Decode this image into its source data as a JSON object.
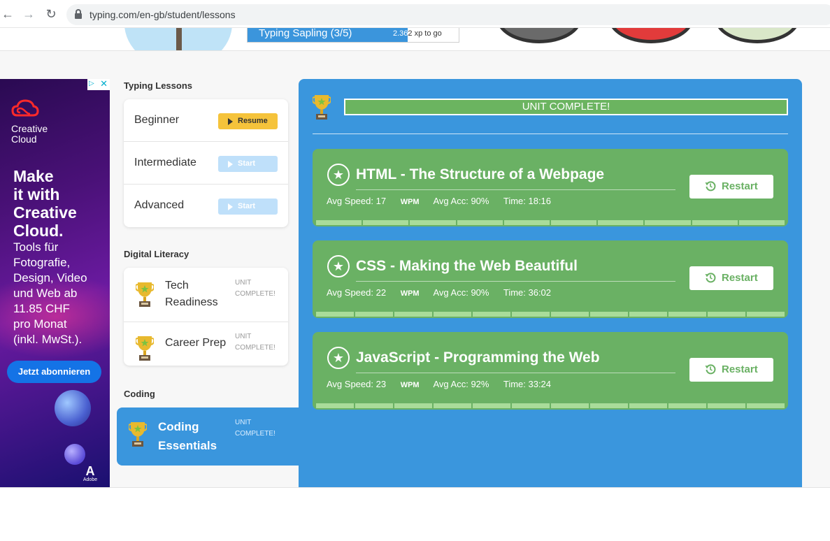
{
  "browser": {
    "url": "typing.com/en-gb/student/lessons",
    "back_glyph": "←",
    "forward_glyph": "→",
    "reload_glyph": "↻"
  },
  "header": {
    "level_label": "Typing Sapling (3/5)",
    "xp_number": "2.36",
    "xp_suffix": "2 xp to go",
    "badge_colors": [
      "#6a6a6a",
      "#e23b3b",
      "#d9e7c8"
    ]
  },
  "ad": {
    "choice": "▷",
    "close": "✕",
    "brand_line1": "Creative",
    "brand_line2": "Cloud",
    "headline_1": "Make",
    "headline_2": "it with",
    "headline_3": "Creative",
    "headline_4": "Cloud.",
    "copy_1": "Tools für",
    "copy_2": "Fotografie,",
    "copy_3": "Design, Video",
    "copy_4": "und Web ab",
    "copy_5": "11.85 CHF",
    "copy_6": "pro Monat",
    "copy_7": "(inkl. MwSt.).",
    "cta": "Jetzt abonnieren",
    "adobe_mark": "A",
    "adobe_text": "Adobe"
  },
  "sidebar": {
    "typing_title": "Typing Lessons",
    "typing_items": [
      {
        "label": "Beginner",
        "action": "Resume"
      },
      {
        "label": "Intermediate",
        "action": "Start"
      },
      {
        "label": "Advanced",
        "action": "Start"
      }
    ],
    "literacy_title": "Digital Literacy",
    "literacy_items": [
      {
        "name_1": "Tech",
        "name_2": "Readiness",
        "status_1": "UNIT",
        "status_2": "COMPLETE!"
      },
      {
        "name_1": "Career Prep",
        "status_1": "UNIT",
        "status_2": "COMPLETE!"
      }
    ],
    "coding_title": "Coding",
    "coding_item": {
      "name_1": "Coding",
      "name_2": "Essentials",
      "status_1": "UNIT",
      "status_2": "COMPLETE!"
    }
  },
  "content": {
    "banner": "UNIT COMPLETE!",
    "courses": [
      {
        "title": "HTML - The Structure of a Webpage",
        "speed_label": "Avg Speed: 17",
        "wpm": "WPM",
        "acc": "Avg Acc: 90%",
        "time": "Time: 18:16",
        "button": "Restart",
        "progress_segments": 10
      },
      {
        "title": "CSS - Making the Web Beautiful",
        "speed_label": "Avg Speed: 22",
        "wpm": "WPM",
        "acc": "Avg Acc: 90%",
        "time": "Time: 36:02",
        "button": "Restart",
        "progress_segments": 12
      },
      {
        "title": "JavaScript - Programming the Web",
        "speed_label": "Avg Speed: 23",
        "wpm": "WPM",
        "acc": "Avg Acc: 92%",
        "time": "Time: 33:24",
        "button": "Restart",
        "progress_segments": 12
      }
    ]
  },
  "colors": {
    "accent_blue": "#3a96dd",
    "complete_green": "#6ab164",
    "resume_yellow": "#f5c33b"
  }
}
